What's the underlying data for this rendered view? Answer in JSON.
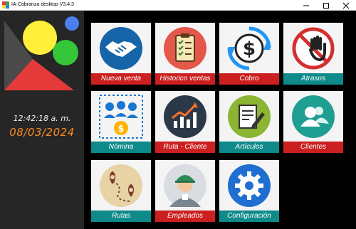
{
  "window": {
    "title": "IA-Cobranza desktop V3.4.3",
    "controls": [
      "minimize",
      "maximize",
      "close"
    ]
  },
  "sidebar": {
    "time": "12:42:18 a. m.",
    "date": "08/03/2024"
  },
  "tiles": [
    {
      "label": "Nueva venta",
      "icon": "handshake-icon",
      "color": "#cc1f1f"
    },
    {
      "label": "Historico ventas",
      "icon": "clipboard-checklist-icon",
      "color": "#cc1f1f"
    },
    {
      "label": "Cobro",
      "icon": "dollar-refresh-icon",
      "color": "#cc1f1f"
    },
    {
      "label": "Atrasos",
      "icon": "stop-hand-icon",
      "color": "#0f8a8a"
    },
    {
      "label": "Nómina",
      "icon": "payroll-people-icon",
      "color": "#0f8a8a"
    },
    {
      "label": "Ruta - Cliente",
      "icon": "growth-chart-icon",
      "color": "#cc1f1f"
    },
    {
      "label": "Artículos",
      "icon": "notepad-pencil-icon",
      "color": "#0f8a8a"
    },
    {
      "label": "Clientes",
      "icon": "users-icon",
      "color": "#cc1f1f"
    },
    {
      "label": "Rutas",
      "icon": "route-map-icon",
      "color": "#0f8a8a"
    },
    {
      "label": "Empleados",
      "icon": "worker-icon",
      "color": "#cc1f1f"
    },
    {
      "label": "Configuración",
      "icon": "gear-icon",
      "color": "#0f8a8a"
    }
  ]
}
